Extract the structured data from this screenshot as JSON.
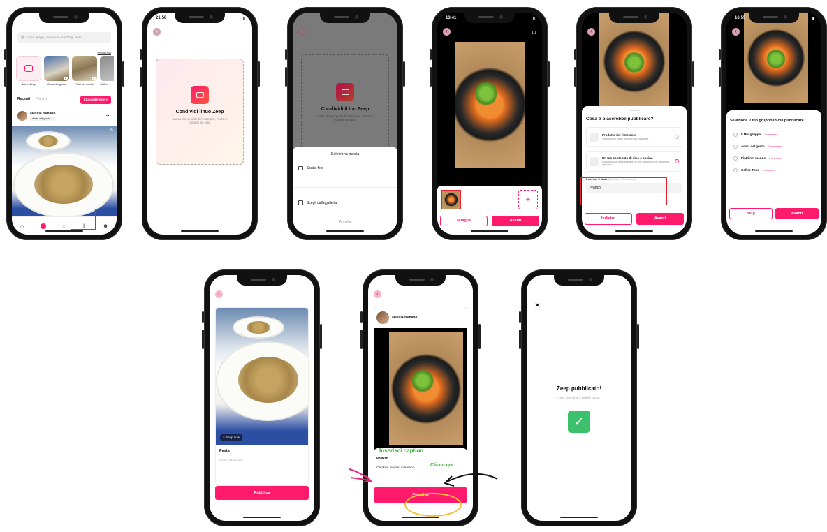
{
  "s1": {
    "search_placeholder": "Cerca gruppi, username, hashtag, titolo",
    "see_groups": "vedi gruppi",
    "stories": [
      "Nuovo Zeep",
      "Amici del gusto",
      "Piatti nel mondo",
      "Coffee"
    ],
    "story_badges": [
      "2",
      "3"
    ],
    "tab_recent": "Recenti",
    "tab_viewed": "Più visti",
    "interests_btn": "I tuoi interessi",
    "post_user": "alessia.romano",
    "post_group": "Amici del gusto"
  },
  "s2": {
    "time": "21:58",
    "title": "Condividi il tuo Zeep",
    "subtitle": "Carica foto di piatti del ristorante, ricette e consigli sul cibo."
  },
  "s3": {
    "title": "Condividi il tuo Zeep",
    "subtitle": "Carica foto di piatti del ristorante, ricette e consigli sul cibo.",
    "sheet_title": "Seleziona media",
    "take_photo": "Scatta foto",
    "gallery": "Scegli dalla galleria",
    "cancel": "Annulla"
  },
  "s4": {
    "time": "13:41",
    "counter": "1/1",
    "crop": "Ritaglia",
    "next": "Avanti"
  },
  "s5": {
    "question": "Cosa ti piacerebbe pubblicare?",
    "opt1_title": "Prodotto del ristorante",
    "opt1_desc": "Condividi un piatto specifico del ristorante",
    "opt2_title": "Un tuo contenuto di cibo o cucina",
    "opt2_desc": "Condividi una tua creazione, un tuo consiglio o un contenuto specifico",
    "title_label": "Inserisci il titolo",
    "title_hint": "(Massimo 30 caratteri)",
    "title_value": "Pranzo",
    "back": "Indietro",
    "next": "Avanti"
  },
  "s6": {
    "time": "16:55",
    "heading": "Seleziona il tuo gruppo in cui pubblicare",
    "groups": [
      {
        "name": "Il Mio gruppo",
        "members": "1 members"
      },
      {
        "name": "Amici del gusto",
        "members": "1 members"
      },
      {
        "name": "Piatti nel mondo",
        "members": "2 members"
      },
      {
        "name": "Coffee Time",
        "members": "3 members"
      }
    ],
    "skip": "Skip",
    "next": "Avanti"
  },
  "s7": {
    "shop_now": "Shop now",
    "title": "Pasta",
    "caption_placeholder": "Scrivi didascalia...",
    "publish": "Pubblica"
  },
  "s8": {
    "username": "alessia.romano",
    "annot_caption": "Inserisci caption",
    "annot_click": "Clicca qui",
    "title": "Pranzo",
    "caption": "Chicken teriyaki in Milano",
    "publish": "Pubblica"
  },
  "s9": {
    "close": "×",
    "heading": "Zeep pubblicato!",
    "sub": "Il tuo Zeep è ora visibile a tutti."
  },
  "colors": {
    "accent": "#ff1a6c",
    "annot_red": "#e8232f",
    "annot_yellow": "#f2c230",
    "annot_green": "#35b032"
  }
}
